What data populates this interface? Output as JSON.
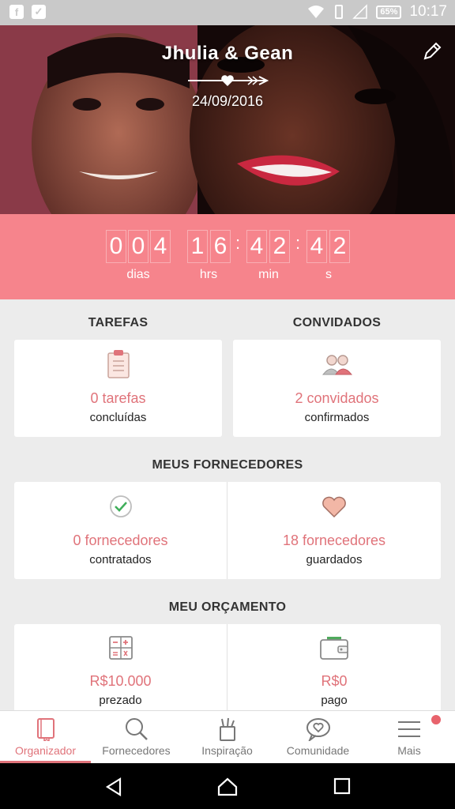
{
  "status_bar": {
    "battery": "65%",
    "time": "10:17"
  },
  "header": {
    "names": "Jhulia & Gean",
    "date": "24/09/2016"
  },
  "countdown": {
    "days": [
      "0",
      "0",
      "4"
    ],
    "hours": [
      "1",
      "6"
    ],
    "minutes": [
      "4",
      "2"
    ],
    "seconds": [
      "4",
      "2"
    ],
    "labels": {
      "days": "dias",
      "hours": "hrs",
      "minutes": "min",
      "seconds": "s"
    }
  },
  "sections": {
    "tasks_title": "TAREFAS",
    "guests_title": "CONVIDADOS",
    "vendors_title": "MEUS FORNECEDORES",
    "budget_title": "MEU ORÇAMENTO"
  },
  "cards": {
    "tasks": {
      "value": "0 tarefas",
      "sub": "concluídas"
    },
    "guests": {
      "value": "2 convidados",
      "sub": "confirmados"
    },
    "vendors_hired": {
      "value": "0 fornecedores",
      "sub": "contratados"
    },
    "vendors_saved": {
      "value": "18 fornecedores",
      "sub": "guardados"
    },
    "budget_estimated": {
      "value": "R$10.000",
      "sub": "prezado"
    },
    "budget_paid": {
      "value": "R$0",
      "sub": "pago"
    }
  },
  "nav": [
    {
      "label": "Organizador",
      "icon": "notebook-icon"
    },
    {
      "label": "Fornecedores",
      "icon": "magnifier-icon"
    },
    {
      "label": "Inspiração",
      "icon": "pencil-cup-icon"
    },
    {
      "label": "Comunidade",
      "icon": "chat-heart-icon"
    },
    {
      "label": "Mais",
      "icon": "menu-icon"
    }
  ],
  "colors": {
    "accent": "#e0737a",
    "countdown_bg": "#f6848c"
  }
}
